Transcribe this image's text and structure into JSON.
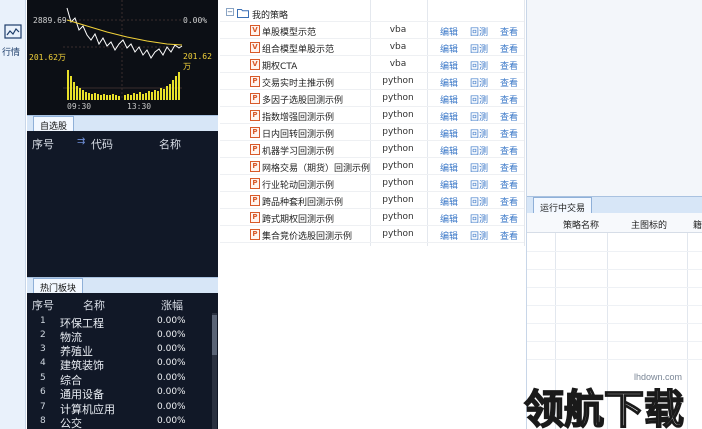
{
  "nav": {
    "label": "行情",
    "icon": "chart-line-icon"
  },
  "mini_chart": {
    "price": "2889.69",
    "change_pct": "0.00%",
    "vol_left": "201.62万",
    "vol_right": "201.62万",
    "time_start": "09:30",
    "time_mid": "13:30"
  },
  "watchlist": {
    "tab": "自选股",
    "headers": {
      "seq": "序号",
      "code": "代码",
      "name": "名称"
    }
  },
  "hot_sectors": {
    "tab": "热门板块",
    "headers": {
      "seq": "序号",
      "name": "名称",
      "change": "涨幅"
    },
    "rows": [
      {
        "idx": "1",
        "name": "环保工程",
        "change": "0.00%"
      },
      {
        "idx": "2",
        "name": "物流",
        "change": "0.00%"
      },
      {
        "idx": "3",
        "name": "养殖业",
        "change": "0.00%"
      },
      {
        "idx": "4",
        "name": "建筑装饰",
        "change": "0.00%"
      },
      {
        "idx": "5",
        "name": "综合",
        "change": "0.00%"
      },
      {
        "idx": "6",
        "name": "通用设备",
        "change": "0.00%"
      },
      {
        "idx": "7",
        "name": "计算机应用",
        "change": "0.00%"
      },
      {
        "idx": "8",
        "name": "公交",
        "change": "0.00%"
      }
    ]
  },
  "strategies": {
    "root": "我的策略",
    "actions": {
      "edit": "编辑",
      "backtest": "回测",
      "view": "查看"
    },
    "items": [
      {
        "name": "单股模型示范",
        "lang": "vba",
        "icon": "V"
      },
      {
        "name": "组合模型单股示范",
        "lang": "vba",
        "icon": "V"
      },
      {
        "name": "期权CTA",
        "lang": "vba",
        "icon": "V"
      },
      {
        "name": "交易实时主推示例",
        "lang": "python",
        "icon": "P"
      },
      {
        "name": "多因子选股回测示例",
        "lang": "python",
        "icon": "P"
      },
      {
        "name": "指数增强回测示例",
        "lang": "python",
        "icon": "P"
      },
      {
        "name": "日内回转回测示例",
        "lang": "python",
        "icon": "P"
      },
      {
        "name": "机器学习回测示例",
        "lang": "python",
        "icon": "P"
      },
      {
        "name": "网格交易（期货）回测示例",
        "lang": "python",
        "icon": "P"
      },
      {
        "name": "行业轮动回测示例",
        "lang": "python",
        "icon": "P"
      },
      {
        "name": "跨品种套利回测示例",
        "lang": "python",
        "icon": "P"
      },
      {
        "name": "跨式期权回测示例",
        "lang": "python",
        "icon": "P"
      },
      {
        "name": "集合竞价选股回测示例",
        "lang": "python",
        "icon": "P"
      }
    ]
  },
  "running": {
    "tab": "运行中交易",
    "headers": {
      "name": "策略名称",
      "main": "主图标的",
      "extra": "籍"
    }
  },
  "watermark": {
    "text": "领航下载",
    "url": "lhdown.com"
  },
  "colors": {
    "dark_bg": "#111827",
    "link": "#3b78c8",
    "vba_icon": "#d85a2a",
    "price_line": "#f2d23a",
    "avg_line": "#ffffff"
  }
}
